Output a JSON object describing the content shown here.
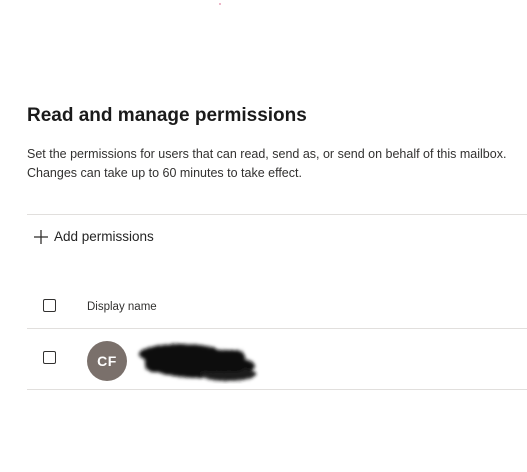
{
  "section": {
    "title": "Read and manage permissions",
    "description": "Set the permissions for users that can read, send as, or send on behalf of this mailbox. Changes can take up to 60 minutes to take effect."
  },
  "toolbar": {
    "add_label": "Add permissions",
    "add_icon": "plus-icon"
  },
  "table": {
    "columns": [
      "Display name"
    ],
    "rows": [
      {
        "initials": "CF",
        "avatar_color": "#7a706b",
        "name_redacted": true
      }
    ]
  }
}
